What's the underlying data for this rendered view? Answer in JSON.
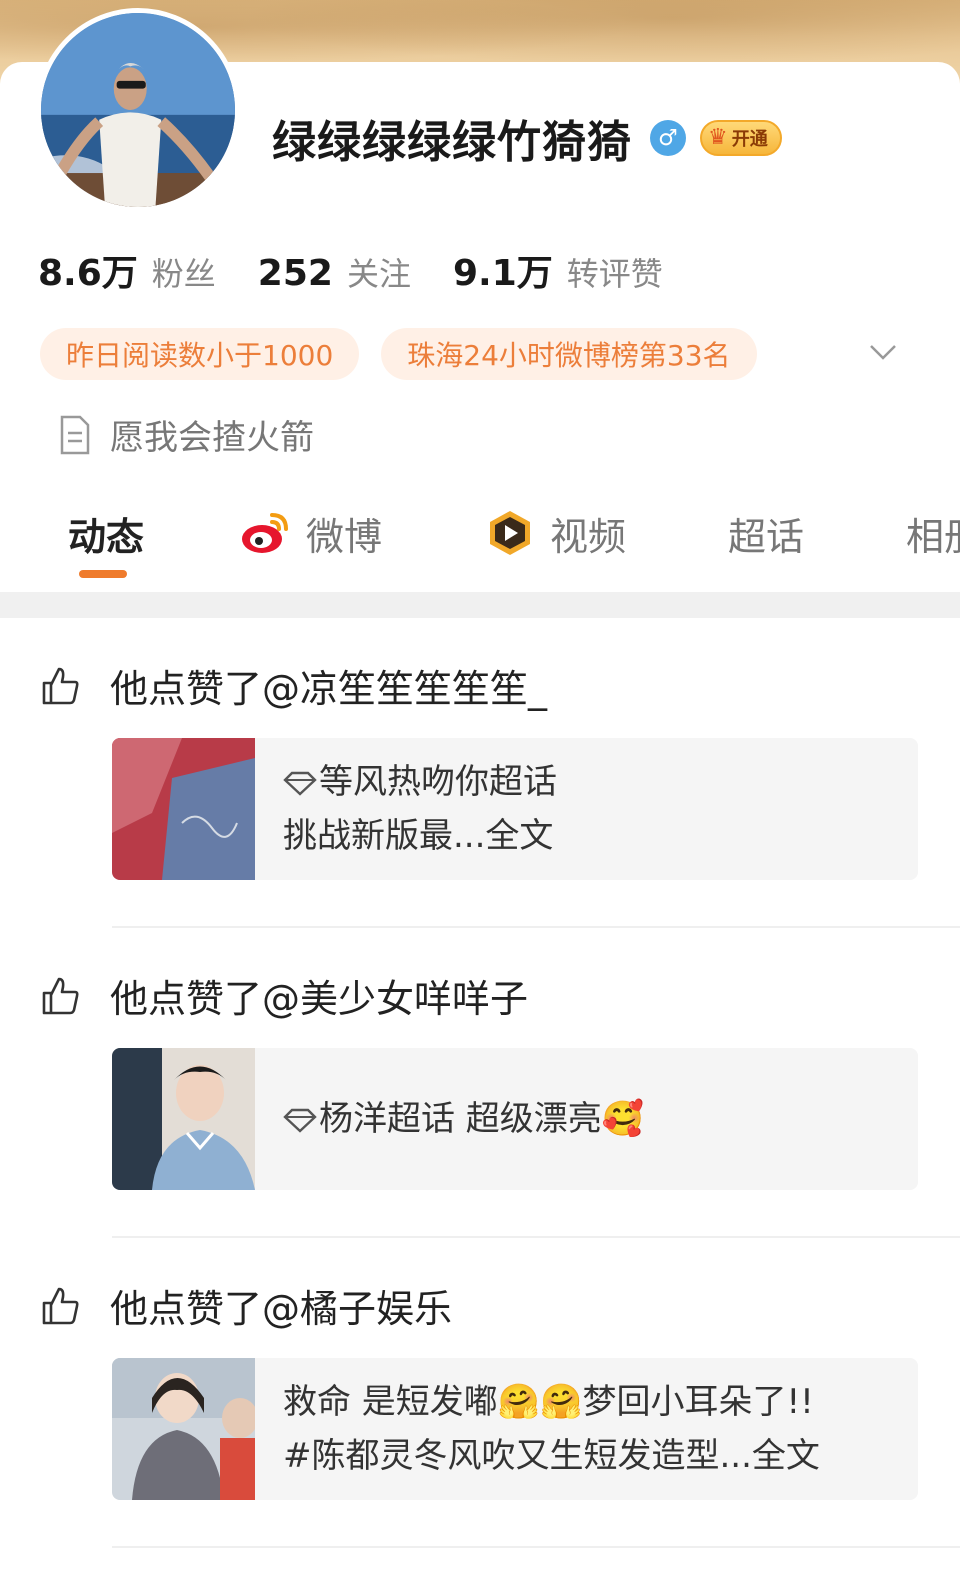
{
  "profile": {
    "name": "绿绿绿绿绿竹猗猗",
    "gender_symbol": "♂",
    "vip_label": "开通",
    "stats": [
      {
        "num": "8.6万",
        "label": "粉丝"
      },
      {
        "num": "252",
        "label": "关注"
      },
      {
        "num": "9.1万",
        "label": "转评赞"
      }
    ],
    "tags": [
      "昨日阅读数小于1000",
      "珠海24小时微博榜第33名"
    ],
    "bio": "愿我会揸火箭"
  },
  "tabs": [
    {
      "label": "动态",
      "active": true
    },
    {
      "label": "微博",
      "icon": "weibo-logo-icon"
    },
    {
      "label": "视频",
      "icon": "video-icon"
    },
    {
      "label": "超话"
    },
    {
      "label": "相册"
    }
  ],
  "feed": [
    {
      "action": "他点赞了@凉笙笙笙笙笙_",
      "line1": "等风热吻你超话",
      "line2": "挑战新版最...全文",
      "thumb_colors": [
        "#c43e52",
        "#6f86b5"
      ]
    },
    {
      "action": "他点赞了@美少女咩咩子",
      "line1": "杨洋超话  超级漂亮🥰",
      "thumb_colors": [
        "#7fa3c9",
        "#d9d2ca"
      ]
    },
    {
      "action": "他点赞了@橘子娱乐",
      "line1": "救命 是短发嘟🤗🤗梦回小耳朵了!!",
      "line2": "#陈都灵冬风吹又生短发造型...全文",
      "thumb_colors": [
        "#a8b6c4",
        "#e8dfd5"
      ]
    }
  ],
  "colors": {
    "accent": "#ef7b2c",
    "tag_bg": "#fff0e6",
    "tag_text": "#ec7e3a"
  }
}
